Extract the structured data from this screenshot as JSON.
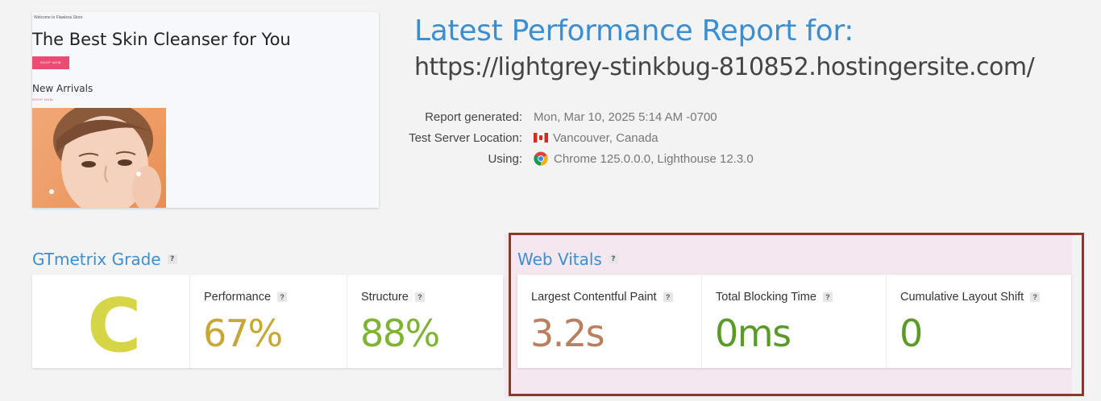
{
  "thumbnail": {
    "welcome_text": "Welcome to Flawless Store",
    "hero_title": "The Best Skin Cleanser for You",
    "shop_button": "SHOP NOW",
    "section_title": "New Arrivals",
    "shop_link": "SHOP NOW"
  },
  "report": {
    "title": "Latest Performance Report for:",
    "url": "https://lightgrey-stinkbug-810852.hostingersite.com/",
    "meta": {
      "generated_label": "Report generated:",
      "generated_value": "Mon, Mar 10, 2025 5:14 AM -0700",
      "location_label": "Test Server Location:",
      "location_value": "Vancouver, Canada",
      "using_label": "Using:",
      "using_value": "Chrome 125.0.0.0, Lighthouse 12.3.0"
    }
  },
  "gtmetrix": {
    "title": "GTmetrix Grade",
    "help": "?",
    "grade": "C",
    "performance_label": "Performance",
    "performance_value": "67%",
    "structure_label": "Structure",
    "structure_value": "88%"
  },
  "web_vitals": {
    "title": "Web Vitals",
    "help": "?",
    "lcp_label": "Largest Contentful Paint",
    "lcp_value": "3.2s",
    "tbt_label": "Total Blocking Time",
    "tbt_value": "0ms",
    "cls_label": "Cumulative Layout Shift",
    "cls_value": "0"
  },
  "colors": {
    "title_blue": "#3b8fd1",
    "grade_c": "#d6d548",
    "performance": "#c8a835",
    "structure": "#7fb334",
    "lcp": "#b97f5f",
    "good": "#5a9b28",
    "highlight_border": "#8b3a2a"
  },
  "icons": {
    "flag": "canada-flag-icon",
    "browser": "chrome-icon",
    "help": "question-mark-icon"
  }
}
